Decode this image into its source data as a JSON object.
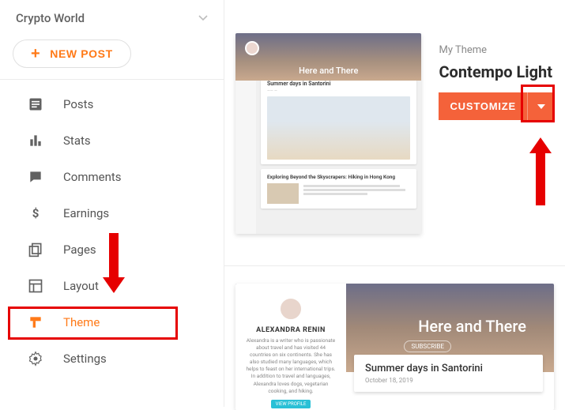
{
  "sidebar": {
    "blog_name": "Crypto World",
    "new_post_label": "NEW POST",
    "items": [
      {
        "label": "Posts",
        "icon": "posts-icon"
      },
      {
        "label": "Stats",
        "icon": "stats-icon"
      },
      {
        "label": "Comments",
        "icon": "comments-icon"
      },
      {
        "label": "Earnings",
        "icon": "earnings-icon"
      },
      {
        "label": "Pages",
        "icon": "pages-icon"
      },
      {
        "label": "Layout",
        "icon": "layout-icon"
      },
      {
        "label": "Theme",
        "icon": "theme-icon",
        "active": true
      },
      {
        "label": "Settings",
        "icon": "settings-icon"
      }
    ]
  },
  "theme_panel": {
    "section_label": "My Theme",
    "current_theme": "Contempo Light",
    "customize_label": "CUSTOMIZE",
    "preview": {
      "blog_title": "Here and There",
      "post1_title": "Summer days in Santorini",
      "post2_title": "Exploring Beyond the Skyscrapers: Hiking in Hong Kong"
    }
  },
  "large_preview": {
    "blog_title": "Here and There",
    "subscribe_label": "SUBSCRIBE",
    "author_name": "ALEXANDRA RENIN",
    "author_bio": "Alexandra is a writer who is passionate about travel and has visited 44 countries on six continents. She has also studied many languages, which helps to feast on her international trips. In addition to travel and languages, Alexandra loves dogs, vegetarian cooking, and hiking.",
    "view_profile_label": "VIEW PROFILE",
    "post_title": "Summer days in Santorini",
    "post_date": "October 18, 2019"
  },
  "annotations": {
    "highlight_theme_nav": true,
    "highlight_dropdown": true
  }
}
